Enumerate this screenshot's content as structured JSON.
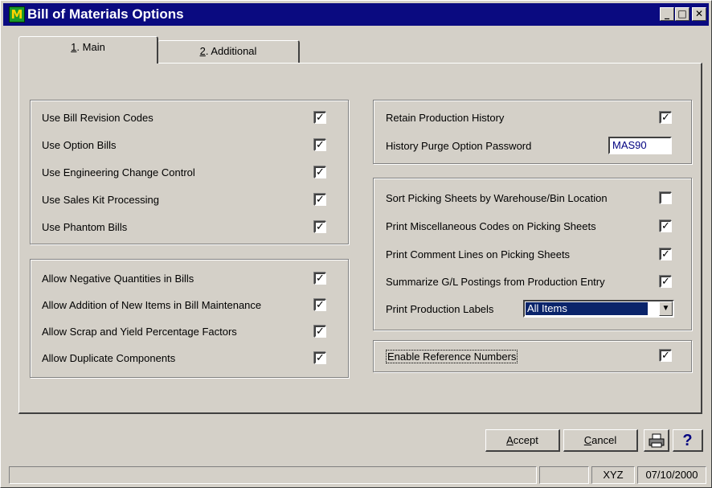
{
  "window": {
    "title": "Bill of Materials Options",
    "app_icon_letter": "M",
    "controls": {
      "minimize": "_",
      "maximize": "□",
      "close": "✕"
    }
  },
  "tabs": [
    {
      "key": "1",
      "label": ". Main",
      "active": true
    },
    {
      "key": "2",
      "label": ". Additional",
      "active": false
    }
  ],
  "left_group1": [
    {
      "label": "Use Bill Revision Codes",
      "checked": true
    },
    {
      "label": "Use Option Bills",
      "checked": true
    },
    {
      "label": "Use Engineering Change Control",
      "checked": true
    },
    {
      "label": "Use Sales Kit Processing",
      "checked": true
    },
    {
      "label": "Use Phantom Bills",
      "checked": true
    }
  ],
  "left_group2": [
    {
      "label": "Allow Negative Quantities in Bills",
      "checked": true
    },
    {
      "label": "Allow Addition of New Items in Bill Maintenance",
      "checked": true
    },
    {
      "label": "Allow Scrap and Yield Percentage Factors",
      "checked": true
    },
    {
      "label": "Allow Duplicate Components",
      "checked": true
    }
  ],
  "right_group1": {
    "retain_label": "Retain Production History",
    "retain_checked": true,
    "password_label": "History Purge Option Password",
    "password_value": "MAS90"
  },
  "right_group2": {
    "items": [
      {
        "label": "Sort Picking Sheets by Warehouse/Bin Location",
        "checked": false
      },
      {
        "label": "Print Miscellaneous Codes on Picking Sheets",
        "checked": true
      },
      {
        "label": "Print Comment Lines on Picking Sheets",
        "checked": true
      },
      {
        "label": "Summarize G/L Postings from Production Entry",
        "checked": true
      }
    ],
    "labels_label": "Print Production Labels",
    "labels_value": "All Items"
  },
  "right_group3": {
    "label": "Enable Reference Numbers",
    "checked": true
  },
  "buttons": {
    "accept_key": "A",
    "accept_rest": "ccept",
    "cancel_key": "C",
    "cancel_rest": "ancel",
    "help": "?"
  },
  "status": {
    "user": "XYZ",
    "date": "07/10/2000"
  },
  "check_glyph": "✓"
}
